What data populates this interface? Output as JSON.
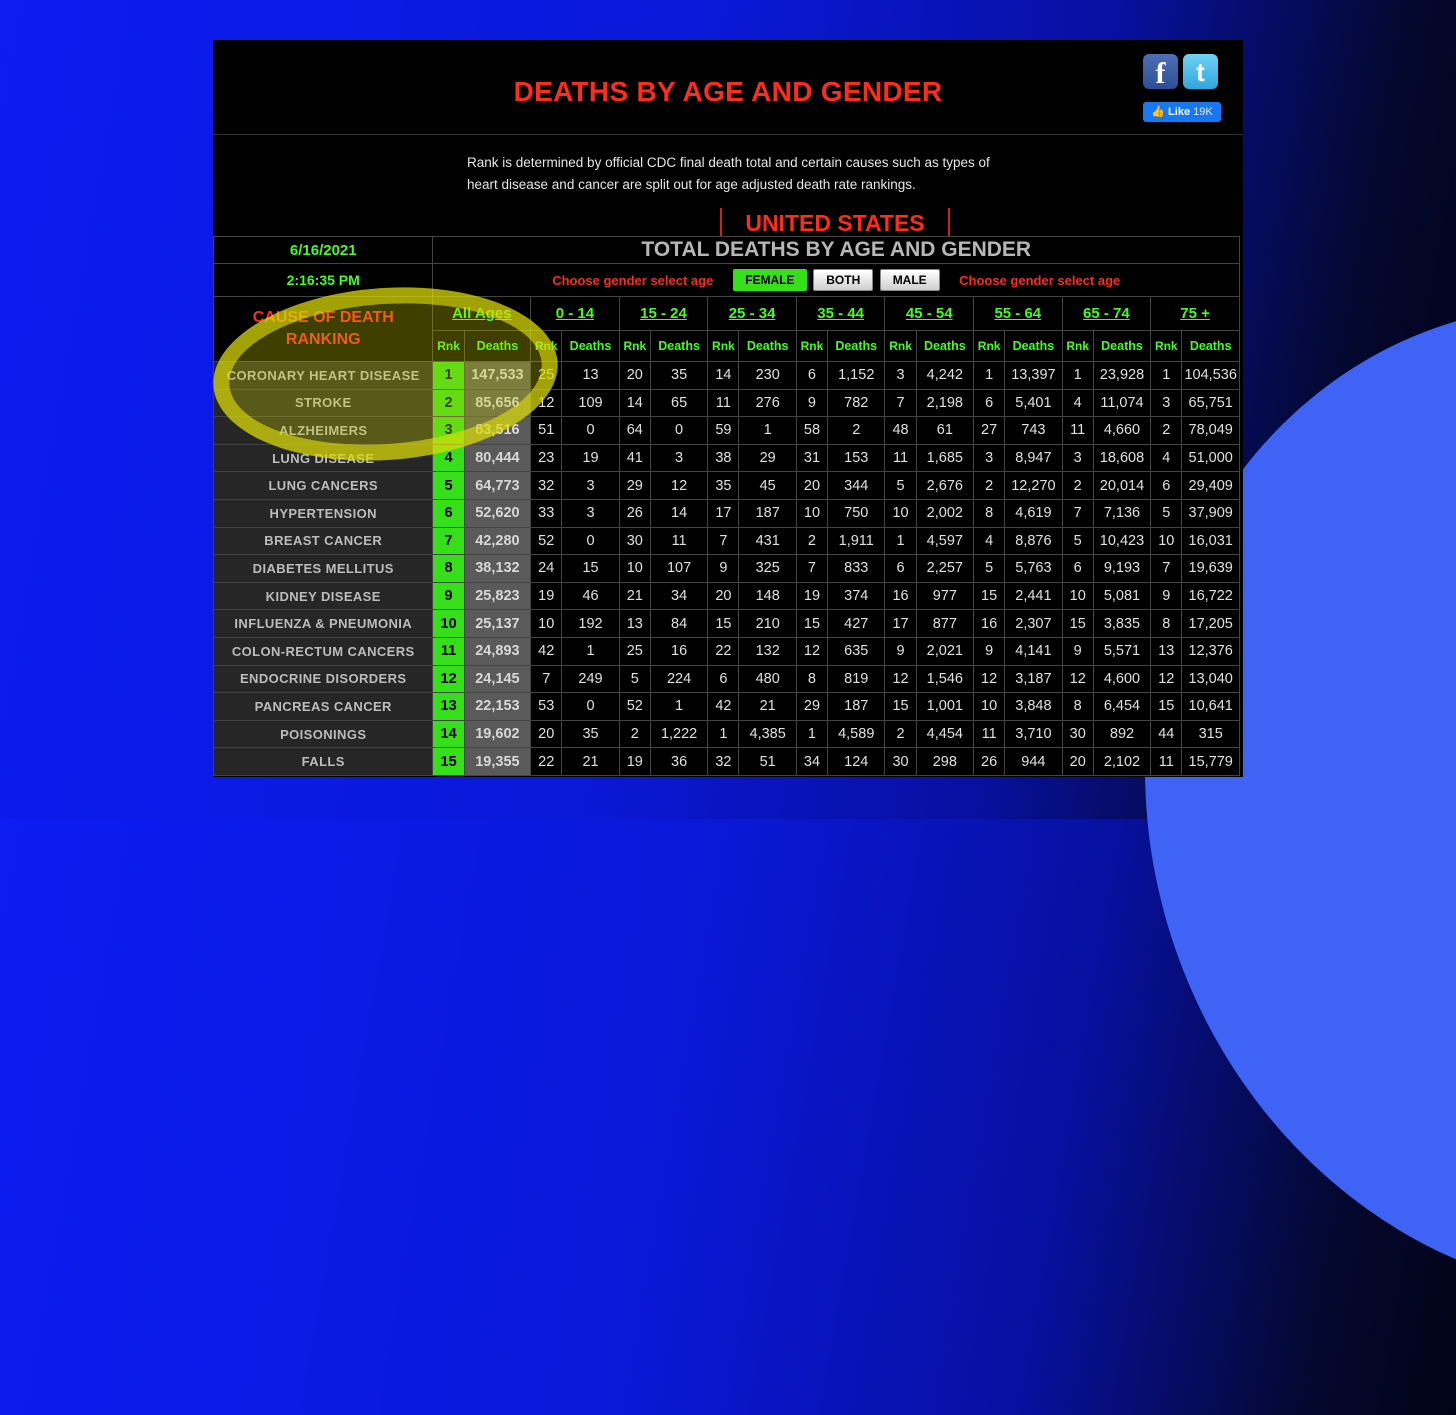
{
  "page": {
    "title": "DEATHS BY AGE AND GENDER",
    "description": "Rank is determined by official CDC final death total and certain causes such as types of heart disease and cancer are split out for age adjusted death rate rankings.",
    "country": "UNITED STATES",
    "date": "6/16/2021",
    "time": "2:16:35 PM",
    "table_title": "TOTAL DEATHS BY AGE AND GENDER"
  },
  "social": {
    "facebook_icon": "facebook-icon",
    "twitter_icon": "twitter-icon",
    "like_label": "Like",
    "like_count": "19K"
  },
  "gender": {
    "prompt": "Choose gender select age",
    "female": "FEMALE",
    "both": "BOTH",
    "male": "MALE",
    "selected": "FEMALE"
  },
  "cause_header_line1": "CAUSE OF DEATH",
  "cause_header_line2": "RANKING",
  "columns": {
    "rank": "Rnk",
    "deaths": "Deaths",
    "age_groups": [
      "All Ages",
      "0 - 14",
      "15 - 24",
      "25 - 34",
      "35 - 44",
      "45 - 54",
      "55 - 64",
      "65 - 74",
      "75 +"
    ]
  },
  "colors": {
    "title_red": "#ff2b1c",
    "accent_green": "#43ff1f",
    "rank_green": "#35e01a",
    "highlight_yellow": "#dede0a"
  },
  "rows": [
    {
      "cause": "CORONARY HEART DISEASE",
      "rank": "1",
      "all": "147,533",
      "ages": [
        [
          "25",
          "13"
        ],
        [
          "20",
          "35"
        ],
        [
          "14",
          "230"
        ],
        [
          "6",
          "1,152"
        ],
        [
          "3",
          "4,242"
        ],
        [
          "1",
          "13,397"
        ],
        [
          "1",
          "23,928"
        ],
        [
          "1",
          "104,536"
        ]
      ]
    },
    {
      "cause": "STROKE",
      "rank": "2",
      "all": "85,656",
      "ages": [
        [
          "12",
          "109"
        ],
        [
          "14",
          "65"
        ],
        [
          "11",
          "276"
        ],
        [
          "9",
          "782"
        ],
        [
          "7",
          "2,198"
        ],
        [
          "6",
          "5,401"
        ],
        [
          "4",
          "11,074"
        ],
        [
          "3",
          "65,751"
        ]
      ]
    },
    {
      "cause": "ALZHEIMERS",
      "rank": "3",
      "all": "83,516",
      "ages": [
        [
          "51",
          "0"
        ],
        [
          "64",
          "0"
        ],
        [
          "59",
          "1"
        ],
        [
          "58",
          "2"
        ],
        [
          "48",
          "61"
        ],
        [
          "27",
          "743"
        ],
        [
          "11",
          "4,660"
        ],
        [
          "2",
          "78,049"
        ]
      ]
    },
    {
      "cause": "LUNG DISEASE",
      "rank": "4",
      "all": "80,444",
      "ages": [
        [
          "23",
          "19"
        ],
        [
          "41",
          "3"
        ],
        [
          "38",
          "29"
        ],
        [
          "31",
          "153"
        ],
        [
          "11",
          "1,685"
        ],
        [
          "3",
          "8,947"
        ],
        [
          "3",
          "18,608"
        ],
        [
          "4",
          "51,000"
        ]
      ]
    },
    {
      "cause": "LUNG CANCERS",
      "rank": "5",
      "all": "64,773",
      "ages": [
        [
          "32",
          "3"
        ],
        [
          "29",
          "12"
        ],
        [
          "35",
          "45"
        ],
        [
          "20",
          "344"
        ],
        [
          "5",
          "2,676"
        ],
        [
          "2",
          "12,270"
        ],
        [
          "2",
          "20,014"
        ],
        [
          "6",
          "29,409"
        ]
      ]
    },
    {
      "cause": "HYPERTENSION",
      "rank": "6",
      "all": "52,620",
      "ages": [
        [
          "33",
          "3"
        ],
        [
          "26",
          "14"
        ],
        [
          "17",
          "187"
        ],
        [
          "10",
          "750"
        ],
        [
          "10",
          "2,002"
        ],
        [
          "8",
          "4,619"
        ],
        [
          "7",
          "7,136"
        ],
        [
          "5",
          "37,909"
        ]
      ]
    },
    {
      "cause": "BREAST CANCER",
      "rank": "7",
      "all": "42,280",
      "ages": [
        [
          "52",
          "0"
        ],
        [
          "30",
          "11"
        ],
        [
          "7",
          "431"
        ],
        [
          "2",
          "1,911"
        ],
        [
          "1",
          "4,597"
        ],
        [
          "4",
          "8,876"
        ],
        [
          "5",
          "10,423"
        ],
        [
          "10",
          "16,031"
        ]
      ]
    },
    {
      "cause": "DIABETES MELLITUS",
      "rank": "8",
      "all": "38,132",
      "ages": [
        [
          "24",
          "15"
        ],
        [
          "10",
          "107"
        ],
        [
          "9",
          "325"
        ],
        [
          "7",
          "833"
        ],
        [
          "6",
          "2,257"
        ],
        [
          "5",
          "5,763"
        ],
        [
          "6",
          "9,193"
        ],
        [
          "7",
          "19,639"
        ]
      ]
    },
    {
      "cause": "KIDNEY DISEASE",
      "rank": "9",
      "all": "25,823",
      "ages": [
        [
          "19",
          "46"
        ],
        [
          "21",
          "34"
        ],
        [
          "20",
          "148"
        ],
        [
          "19",
          "374"
        ],
        [
          "16",
          "977"
        ],
        [
          "15",
          "2,441"
        ],
        [
          "10",
          "5,081"
        ],
        [
          "9",
          "16,722"
        ]
      ]
    },
    {
      "cause": "INFLUENZA & PNEUMONIA",
      "rank": "10",
      "all": "25,137",
      "ages": [
        [
          "10",
          "192"
        ],
        [
          "13",
          "84"
        ],
        [
          "15",
          "210"
        ],
        [
          "15",
          "427"
        ],
        [
          "17",
          "877"
        ],
        [
          "16",
          "2,307"
        ],
        [
          "15",
          "3,835"
        ],
        [
          "8",
          "17,205"
        ]
      ]
    },
    {
      "cause": "COLON-RECTUM CANCERS",
      "rank": "11",
      "all": "24,893",
      "ages": [
        [
          "42",
          "1"
        ],
        [
          "25",
          "16"
        ],
        [
          "22",
          "132"
        ],
        [
          "12",
          "635"
        ],
        [
          "9",
          "2,021"
        ],
        [
          "9",
          "4,141"
        ],
        [
          "9",
          "5,571"
        ],
        [
          "13",
          "12,376"
        ]
      ]
    },
    {
      "cause": "ENDOCRINE DISORDERS",
      "rank": "12",
      "all": "24,145",
      "ages": [
        [
          "7",
          "249"
        ],
        [
          "5",
          "224"
        ],
        [
          "6",
          "480"
        ],
        [
          "8",
          "819"
        ],
        [
          "12",
          "1,546"
        ],
        [
          "12",
          "3,187"
        ],
        [
          "12",
          "4,600"
        ],
        [
          "12",
          "13,040"
        ]
      ]
    },
    {
      "cause": "PANCREAS CANCER",
      "rank": "13",
      "all": "22,153",
      "ages": [
        [
          "53",
          "0"
        ],
        [
          "52",
          "1"
        ],
        [
          "42",
          "21"
        ],
        [
          "29",
          "187"
        ],
        [
          "15",
          "1,001"
        ],
        [
          "10",
          "3,848"
        ],
        [
          "8",
          "6,454"
        ],
        [
          "15",
          "10,641"
        ]
      ]
    },
    {
      "cause": "POISONINGS",
      "rank": "14",
      "all": "19,602",
      "ages": [
        [
          "20",
          "35"
        ],
        [
          "2",
          "1,222"
        ],
        [
          "1",
          "4,385"
        ],
        [
          "1",
          "4,589"
        ],
        [
          "2",
          "4,454"
        ],
        [
          "11",
          "3,710"
        ],
        [
          "30",
          "892"
        ],
        [
          "44",
          "315"
        ]
      ]
    },
    {
      "cause": "FALLS",
      "rank": "15",
      "all": "19,355",
      "ages": [
        [
          "22",
          "21"
        ],
        [
          "19",
          "36"
        ],
        [
          "32",
          "51"
        ],
        [
          "34",
          "124"
        ],
        [
          "30",
          "298"
        ],
        [
          "26",
          "944"
        ],
        [
          "20",
          "2,102"
        ],
        [
          "11",
          "15,779"
        ]
      ]
    }
  ]
}
